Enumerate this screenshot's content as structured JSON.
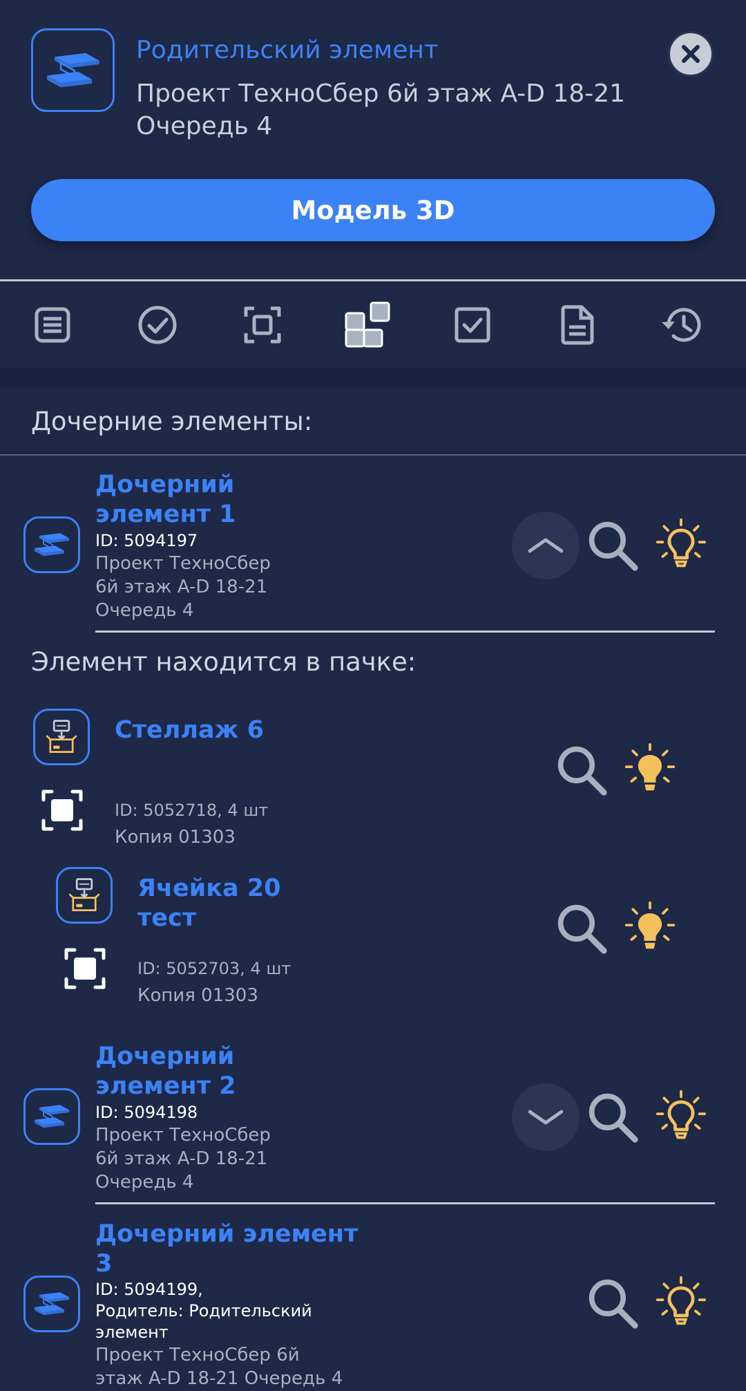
{
  "header": {
    "label": "Родительский элемент",
    "path": "Проект ТехноСбер 6й этаж A-D 18-21 Очередь 4",
    "model_button": "Модель 3D"
  },
  "toolbar": {
    "icons": [
      "list-icon",
      "check-circle-icon",
      "frame-icon",
      "blocks-icon",
      "checkbox-icon",
      "document-icon",
      "history-icon"
    ]
  },
  "children_title": "Дочерние элементы:",
  "children": [
    {
      "title_line1": "Дочерний",
      "title_line2": "элемент 1",
      "id": "ID: 5094197",
      "path1": "Проект ТехноСбер",
      "path2": "6й этаж A-D 18-21",
      "path3": "Очередь 4"
    },
    {
      "title_line1": "Дочерний",
      "title_line2": "элемент 2",
      "id": "ID: 5094198",
      "path1": "Проект ТехноСбер",
      "path2": "6й этаж A-D 18-21",
      "path3": "Очередь 4"
    },
    {
      "title_line1": "Дочерний элемент",
      "title_line2": "3",
      "id": "ID: 5094199,",
      "parent1": "Родитель: Родительский",
      "parent2": "элемент",
      "path1": "Проект ТехноСбер 6й",
      "path2": "этаж A-D 18-21 Очередь 4"
    }
  ],
  "pack_title": "Элемент находится в пачке:",
  "packs": [
    {
      "title_line1": "Стеллаж 6",
      "id": "ID: 5052718, 4 шт",
      "copy": "Копия 01303"
    },
    {
      "title_line1": "Ячейка 20",
      "title_line2": "тест",
      "id": "ID: 5052703, 4 шт",
      "copy": "Копия 01303"
    }
  ],
  "colors": {
    "background": "#1e2847",
    "accent": "#3b82f6",
    "bulb": "#f5c15c"
  }
}
